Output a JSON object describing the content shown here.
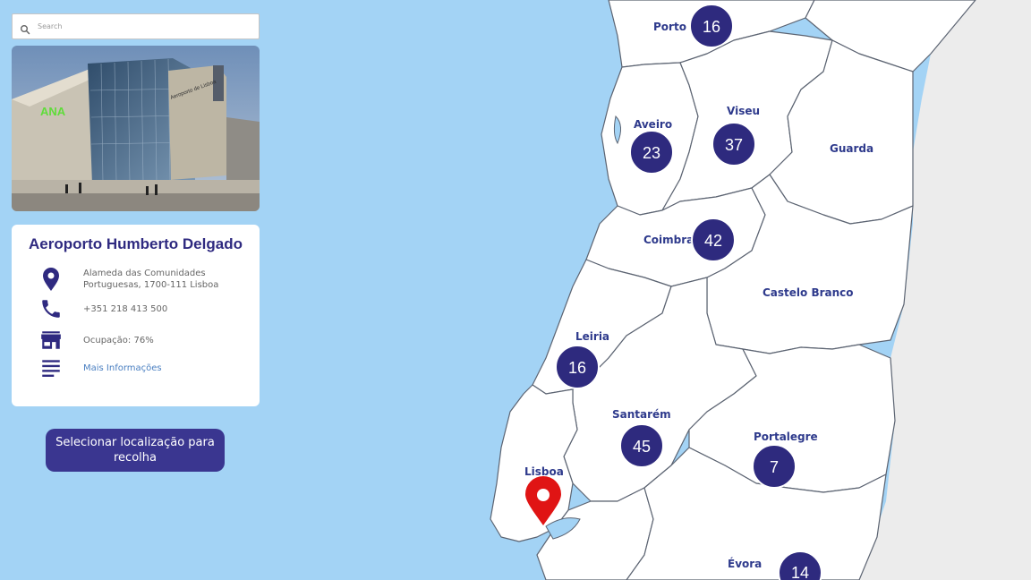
{
  "search": {
    "placeholder": "Search"
  },
  "location": {
    "title": "Aeroporto Humberto Delgado",
    "address_line1": "Alameda das Comunidades",
    "address_line2": "Portuguesas, 1700-111 Lisboa",
    "phone": "+351 218 413 500",
    "occupancy": "Ocupação: 76%",
    "more_info": "Mais Informações",
    "photo_sign": "ANA",
    "photo_label": "Aeroporto de Lisboa"
  },
  "actions": {
    "select_pickup": "Selecionar localização para recolha"
  },
  "map": {
    "regions": {
      "porto": "Porto",
      "aveiro": "Aveiro",
      "viseu": "Viseu",
      "guarda": "Guarda",
      "coimbra": "Coimbra",
      "castelo_branco": "Castelo Branco",
      "leiria": "Leiria",
      "santarem": "Santarém",
      "lisboa": "Lisboa",
      "portalegre": "Portalegre",
      "evora": "Évora"
    },
    "clusters": {
      "porto": "16",
      "aveiro": "23",
      "viseu": "37",
      "coimbra": "42",
      "leiria": "16",
      "santarem": "45",
      "portalegre": "7",
      "evora": "14"
    },
    "colors": {
      "sea": "#a3d3f5",
      "land": "#ffffff",
      "spain": "#ececec",
      "cluster": "#2e2a7e",
      "marker": "#e01414"
    }
  },
  "icons": {
    "search": "search-icon",
    "location": "location-pin-icon",
    "phone": "phone-icon",
    "store": "store-icon",
    "details": "details-list-icon",
    "marker": "map-marker-icon"
  }
}
